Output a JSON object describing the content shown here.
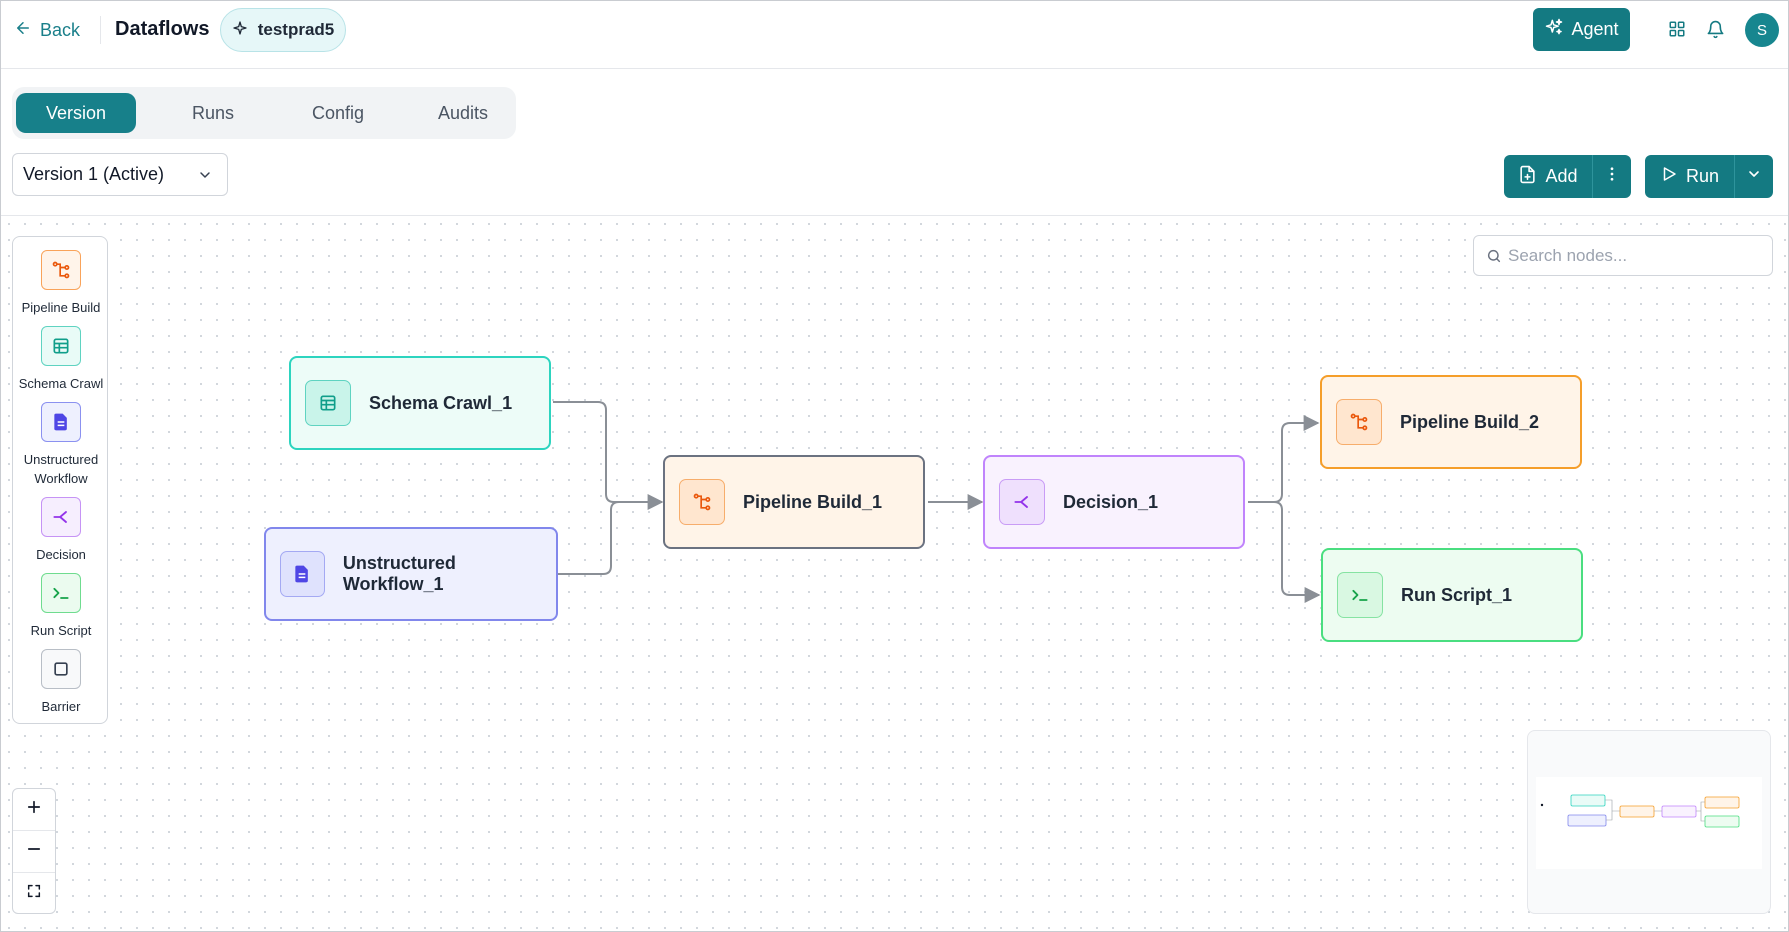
{
  "header": {
    "back_label": "Back",
    "title": "Dataflows",
    "workspace": "testprad5",
    "agent_label": "Agent",
    "avatar_initial": "S"
  },
  "tabs": [
    {
      "label": "Version",
      "active": true
    },
    {
      "label": "Runs",
      "active": false
    },
    {
      "label": "Config",
      "active": false
    },
    {
      "label": "Audits",
      "active": false
    }
  ],
  "version_select": {
    "value": "Version 1 (Active)"
  },
  "toolbar": {
    "add_label": "Add",
    "run_label": "Run"
  },
  "search": {
    "placeholder": "Search nodes..."
  },
  "palette": [
    {
      "label": "Pipeline Build",
      "icon": "pipeline-icon"
    },
    {
      "label": "Schema Crawl",
      "icon": "table-icon"
    },
    {
      "label": "Unstructured Workflow",
      "icon": "document-icon"
    },
    {
      "label": "Decision",
      "icon": "decision-icon"
    },
    {
      "label": "Run Script",
      "icon": "terminal-icon"
    },
    {
      "label": "Barrier",
      "icon": "square-icon"
    }
  ],
  "nodes": {
    "schema_crawl_1": "Schema Crawl_1",
    "unstructured_workflow_1": "Unstructured Workflow_1",
    "pipeline_build_1": "Pipeline Build_1",
    "decision_1": "Decision_1",
    "pipeline_build_2": "Pipeline Build_2",
    "run_script_1": "Run Script_1"
  },
  "colors": {
    "accent": "#147a82",
    "pipeline": "#f97316",
    "schema": "#14b8a6",
    "unstructured": "#6366f1",
    "decision": "#a855f7",
    "run_script": "#22c55e"
  }
}
